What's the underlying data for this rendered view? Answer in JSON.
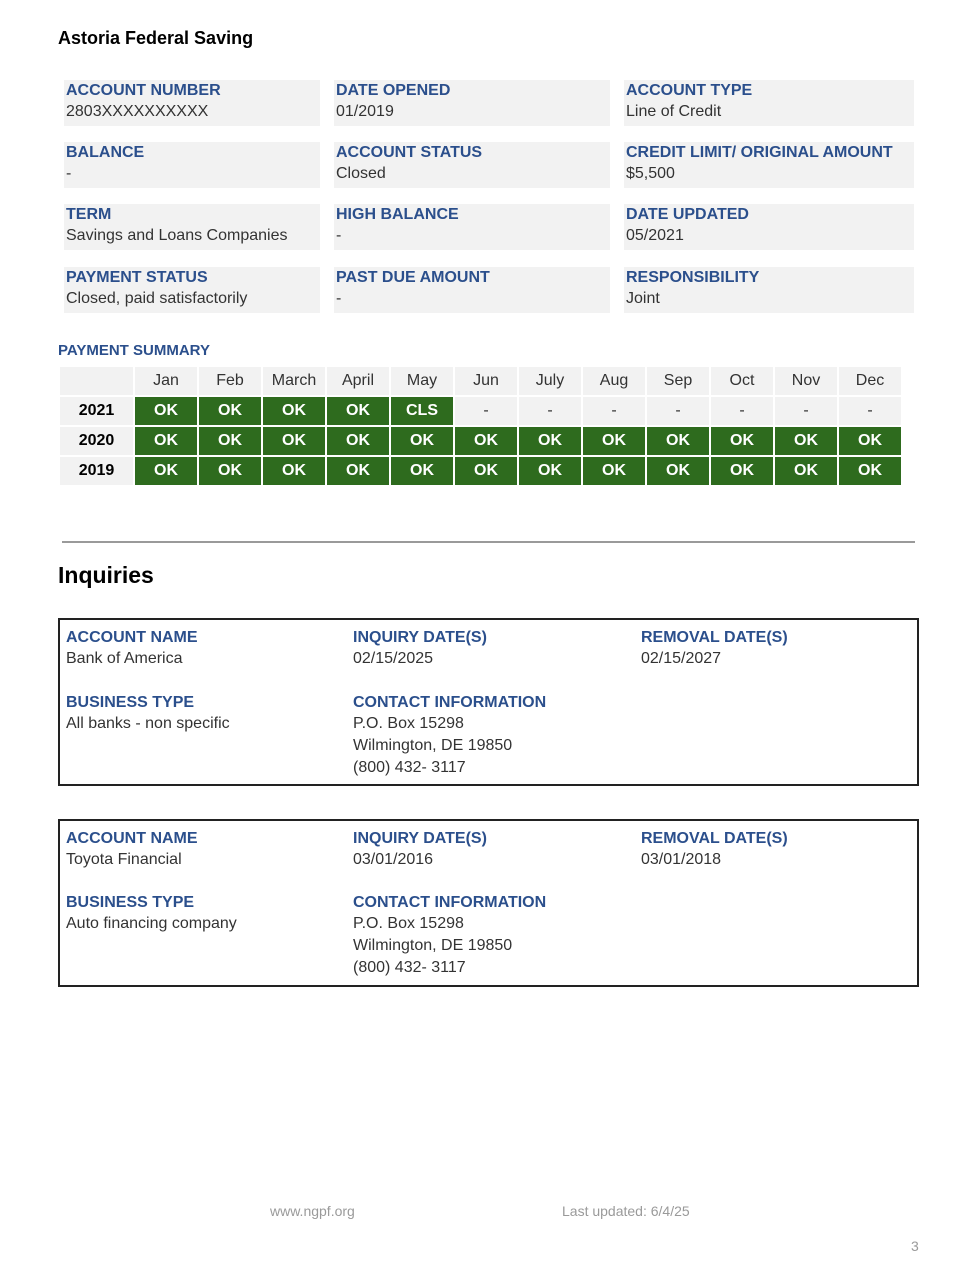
{
  "account": {
    "creditor": "Astoria Federal Saving",
    "fields": [
      {
        "label": "ACCOUNT NUMBER",
        "value": "2803XXXXXXXXXX"
      },
      {
        "label": "DATE OPENED",
        "value": "01/2019"
      },
      {
        "label": "ACCOUNT TYPE",
        "value": "Line of Credit"
      },
      {
        "label": "BALANCE",
        "value": "-"
      },
      {
        "label": "ACCOUNT STATUS",
        "value": "Closed"
      },
      {
        "label": "CREDIT LIMIT/ ORIGINAL AMOUNT",
        "value": "$5,500"
      },
      {
        "label": "TERM",
        "value": "Savings and Loans Companies"
      },
      {
        "label": "HIGH BALANCE",
        "value": "-"
      },
      {
        "label": "DATE UPDATED",
        "value": "05/2021"
      },
      {
        "label": "PAYMENT STATUS",
        "value": "Closed, paid satisfactorily"
      },
      {
        "label": "PAST DUE AMOUNT",
        "value": "-"
      },
      {
        "label": "RESPONSIBILITY",
        "value": "Joint"
      }
    ]
  },
  "payment_summary": {
    "title": "PAYMENT SUMMARY",
    "months": [
      "Jan",
      "Feb",
      "March",
      "April",
      "May",
      "Jun",
      "July",
      "Aug",
      "Sep",
      "Oct",
      "Nov",
      "Dec"
    ],
    "rows": [
      {
        "year": "2021",
        "statuses": [
          "OK",
          "OK",
          "OK",
          "OK",
          "CLS",
          "-",
          "-",
          "-",
          "-",
          "-",
          "-",
          "-"
        ]
      },
      {
        "year": "2020",
        "statuses": [
          "OK",
          "OK",
          "OK",
          "OK",
          "OK",
          "OK",
          "OK",
          "OK",
          "OK",
          "OK",
          "OK",
          "OK"
        ]
      },
      {
        "year": "2019",
        "statuses": [
          "OK",
          "OK",
          "OK",
          "OK",
          "OK",
          "OK",
          "OK",
          "OK",
          "OK",
          "OK",
          "OK",
          "OK"
        ]
      }
    ],
    "colors": {
      "ok": "#2e6b1e",
      "empty": "#f2f2f2"
    }
  },
  "inquiries": {
    "title": "Inquiries",
    "labels": {
      "account_name": "ACCOUNT NAME",
      "inquiry_dates": "INQUIRY DATE(S)",
      "removal_dates": "REMOVAL DATE(S)",
      "business_type": "BUSINESS TYPE",
      "contact_info": "CONTACT INFORMATION"
    },
    "items": [
      {
        "account_name": "Bank of America",
        "inquiry_date": "02/15/2025",
        "removal_date": "02/15/2027",
        "business_type": "All banks - non specific",
        "contact": [
          "P.O. Box 15298",
          "Wilmington, DE 19850",
          "(800) 432- 3117"
        ]
      },
      {
        "account_name": "Toyota Financial",
        "inquiry_date": "03/01/2016",
        "removal_date": "03/01/2018",
        "business_type": "Auto financing company",
        "contact": [
          "P.O. Box 15298",
          "Wilmington, DE 19850",
          "(800) 432- 3117"
        ]
      }
    ]
  },
  "footer": {
    "site": "www.ngpf.org",
    "updated": "Last updated: 6/4/25",
    "page": "3"
  },
  "colors": {
    "label_blue": "#2b4f8c",
    "field_bg": "#f2f2f2"
  }
}
